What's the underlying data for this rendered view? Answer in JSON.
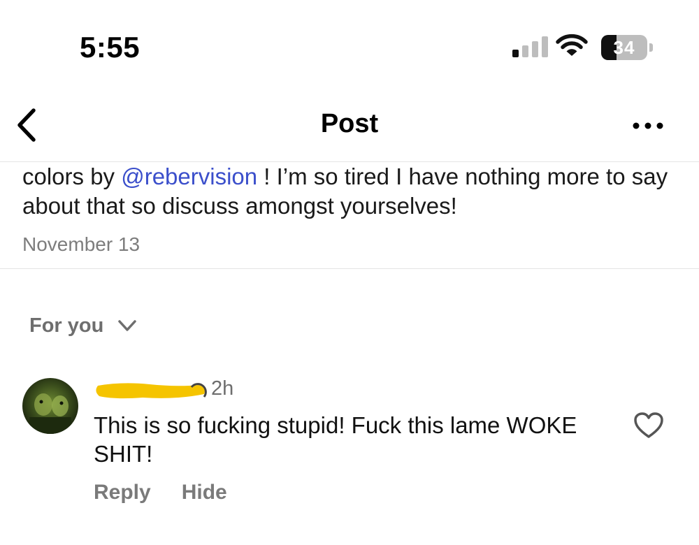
{
  "status_bar": {
    "time": "5:55",
    "signal_icon": "cellular-signal-icon",
    "wifi_icon": "wifi-icon",
    "battery_level": "34",
    "battery_fraction": 0.34
  },
  "nav": {
    "title": "Post",
    "back_icon": "chevron-left-icon",
    "more_icon": "more-horizontal-icon"
  },
  "post": {
    "text_before": "colors by ",
    "mention": "@rebervision",
    "text_after": " ! I’m so tired I have nothing more to say about that so discuss amongst yourselves!",
    "date": "November 13"
  },
  "replies": {
    "sort_label": "For you",
    "sort_icon": "chevron-down-icon"
  },
  "comment": {
    "time": "2h",
    "text": "This is so fucking stupid! Fuck this lame WOKE SHIT!",
    "like_icon": "heart-icon",
    "reply_label": "Reply",
    "hide_label": "Hide"
  },
  "colors": {
    "mention": "#3b4fcb",
    "redaction": "#f5c400",
    "muted_text": "#7d7d7d"
  }
}
